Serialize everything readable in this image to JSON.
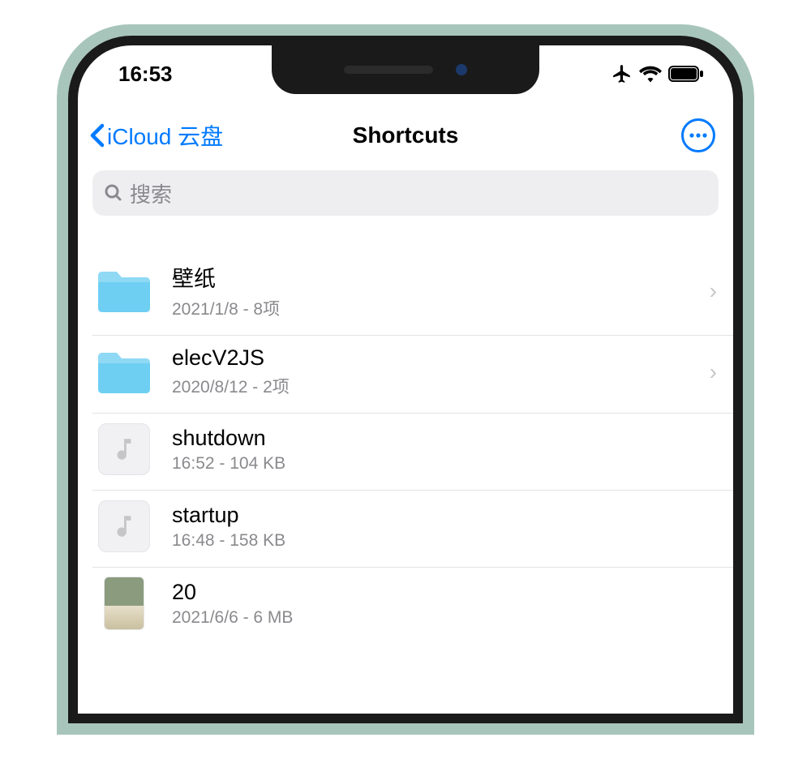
{
  "statusbar": {
    "time": "16:53"
  },
  "navbar": {
    "back_label": "iCloud 云盘",
    "title": "Shortcuts"
  },
  "search": {
    "placeholder": "搜索"
  },
  "list": {
    "items": [
      {
        "type": "folder",
        "name": "壁纸",
        "meta": "2021/1/8 - 8项"
      },
      {
        "type": "folder",
        "name": "elecV2JS",
        "meta": "2020/8/12 - 2项"
      },
      {
        "type": "audio",
        "name": "shutdown",
        "meta": "16:52 - 104 KB"
      },
      {
        "type": "audio",
        "name": "startup",
        "meta": "16:48 - 158 KB"
      },
      {
        "type": "image",
        "name": "20",
        "meta": "2021/6/6 - 6 MB"
      }
    ]
  }
}
